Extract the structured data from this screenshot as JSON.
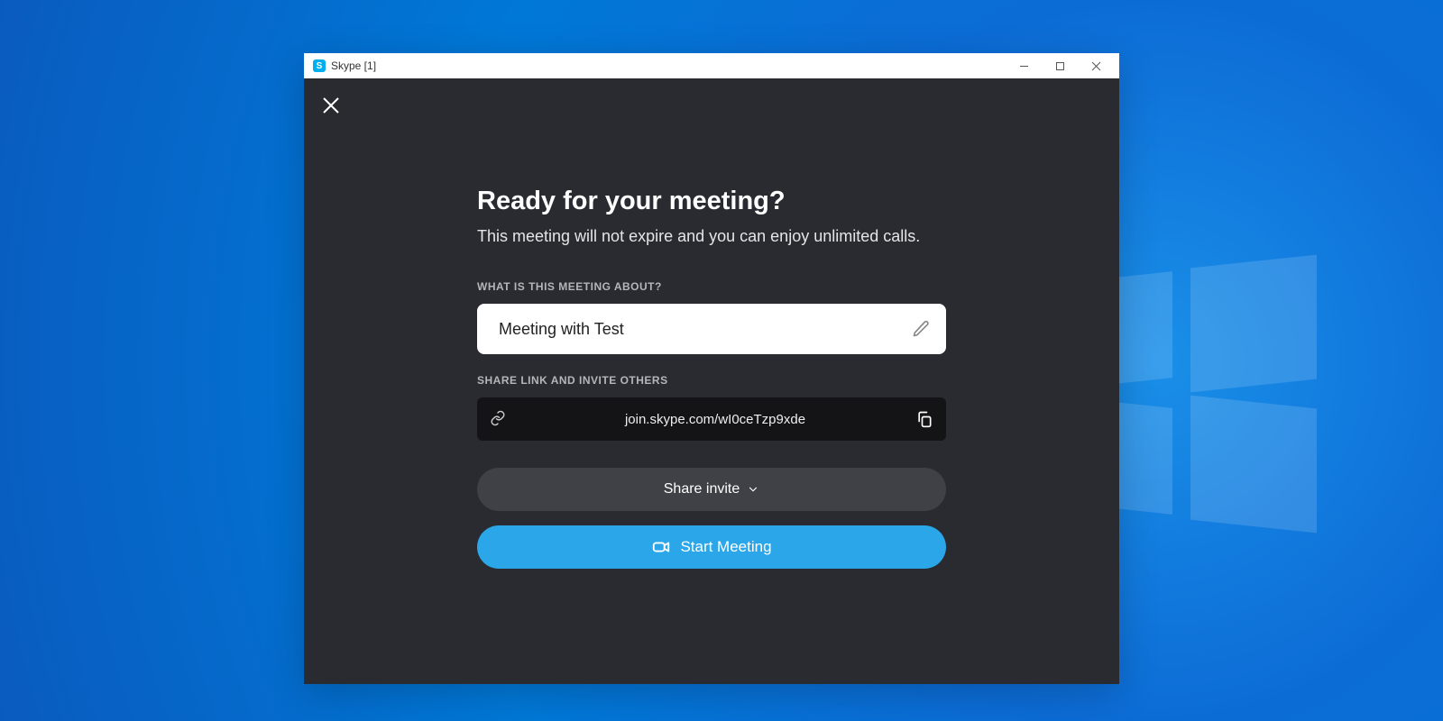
{
  "window": {
    "title": "Skype [1]"
  },
  "content": {
    "heading": "Ready for your meeting?",
    "subtext": "This meeting will not expire and you can enjoy unlimited calls.",
    "topic_label": "WHAT IS THIS MEETING ABOUT?",
    "topic_value": "Meeting with Test",
    "share_label": "SHARE LINK AND INVITE OTHERS",
    "meeting_link": "join.skype.com/wI0ceTzp9xde",
    "share_invite_label": "Share invite",
    "start_meeting_label": "Start Meeting"
  }
}
